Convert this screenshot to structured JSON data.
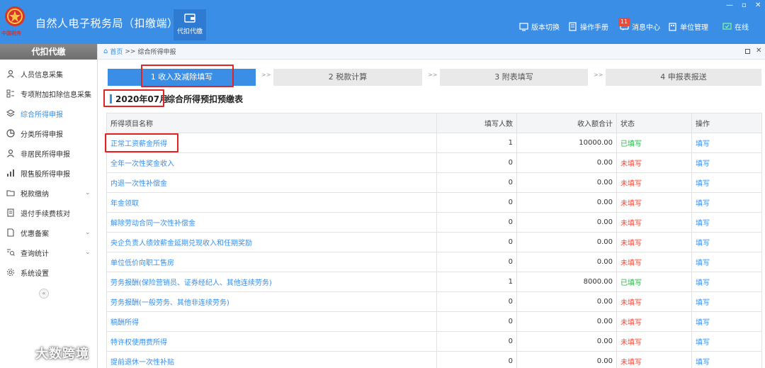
{
  "header": {
    "app_title": "自然人电子税务局（扣缴端）",
    "logo_text": "中国税务",
    "module_tab": "代扣代缴",
    "actions": [
      {
        "label": "版本切换",
        "icon": "switch-icon"
      },
      {
        "label": "操作手册",
        "icon": "book-icon"
      },
      {
        "label": "消息中心",
        "icon": "message-icon",
        "badge": "11"
      },
      {
        "label": "单位管理",
        "icon": "building-icon"
      },
      {
        "label": "在线",
        "icon": "online-icon"
      }
    ],
    "window_controls": [
      "minimize",
      "restore",
      "close"
    ]
  },
  "sidebar": {
    "title": "代扣代缴",
    "items": [
      {
        "label": "人员信息采集",
        "icon": "person-icon"
      },
      {
        "label": "专项附加扣除信息采集",
        "icon": "list-icon"
      },
      {
        "label": "综合所得申报",
        "icon": "layers-icon",
        "active": true
      },
      {
        "label": "分类所得申报",
        "icon": "pie-icon"
      },
      {
        "label": "非居民所得申报",
        "icon": "person-icon"
      },
      {
        "label": "限售股所得申报",
        "icon": "bar-chart-icon"
      },
      {
        "label": "税款缴纳",
        "icon": "folder-icon",
        "expandable": true
      },
      {
        "label": "退付手续费核对",
        "icon": "document-icon"
      },
      {
        "label": "优惠备案",
        "icon": "file-icon",
        "expandable": true
      },
      {
        "label": "查询统计",
        "icon": "search-list-icon",
        "expandable": true
      },
      {
        "label": "系统设置",
        "icon": "gear-icon"
      }
    ],
    "collapse_glyph": "«"
  },
  "watermark": "大数跨境",
  "breadcrumb": {
    "home": "首页",
    "separator": ">>",
    "current": "综合所得申报"
  },
  "steps": [
    {
      "label": "1 收入及减除填写",
      "active": true
    },
    {
      "label": "2 税款计算",
      "active": false
    },
    {
      "label": "3 附表填写",
      "active": false
    },
    {
      "label": "4 申报表报送",
      "active": false
    }
  ],
  "step_separator": ">>",
  "period": "2020年07月",
  "table_title": "综合所得预扣预缴表",
  "table": {
    "columns": [
      "所得项目名称",
      "填写人数",
      "收入额合计",
      "状态",
      "操作"
    ],
    "rows": [
      {
        "item": "正常工资薪金所得",
        "count": "1",
        "income": "10000.00",
        "status": "已填写",
        "done": true,
        "op": "填写"
      },
      {
        "item": "全年一次性奖金收入",
        "count": "0",
        "income": "0.00",
        "status": "未填写",
        "done": false,
        "op": "填写"
      },
      {
        "item": "内退一次性补偿金",
        "count": "0",
        "income": "0.00",
        "status": "未填写",
        "done": false,
        "op": "填写"
      },
      {
        "item": "年金领取",
        "count": "0",
        "income": "0.00",
        "status": "未填写",
        "done": false,
        "op": "填写"
      },
      {
        "item": "解除劳动合同一次性补偿金",
        "count": "0",
        "income": "0.00",
        "status": "未填写",
        "done": false,
        "op": "填写"
      },
      {
        "item": "央企负责人绩效薪金延期兑现收入和任期奖励",
        "count": "0",
        "income": "0.00",
        "status": "未填写",
        "done": false,
        "op": "填写"
      },
      {
        "item": "单位低价向职工售房",
        "count": "0",
        "income": "0.00",
        "status": "未填写",
        "done": false,
        "op": "填写"
      },
      {
        "item": "劳务报酬(保险营销员、证券经纪人、其他连续劳务)",
        "count": "1",
        "income": "8000.00",
        "status": "已填写",
        "done": true,
        "op": "填写"
      },
      {
        "item": "劳务报酬(一般劳务、其他非连续劳务)",
        "count": "0",
        "income": "0.00",
        "status": "未填写",
        "done": false,
        "op": "填写"
      },
      {
        "item": "稿酬所得",
        "count": "0",
        "income": "0.00",
        "status": "未填写",
        "done": false,
        "op": "填写"
      },
      {
        "item": "特许权使用费所得",
        "count": "0",
        "income": "0.00",
        "status": "未填写",
        "done": false,
        "op": "填写"
      },
      {
        "item": "提前退休一次性补贴",
        "count": "0",
        "income": "0.00",
        "status": "未填写",
        "done": false,
        "op": "填写"
      }
    ]
  },
  "colors": {
    "header_bg": "#3a8ee6",
    "accent": "#3a8ee6",
    "done": "#2db34a",
    "not_done": "#e84c3d",
    "highlight_box": "#e32222"
  }
}
